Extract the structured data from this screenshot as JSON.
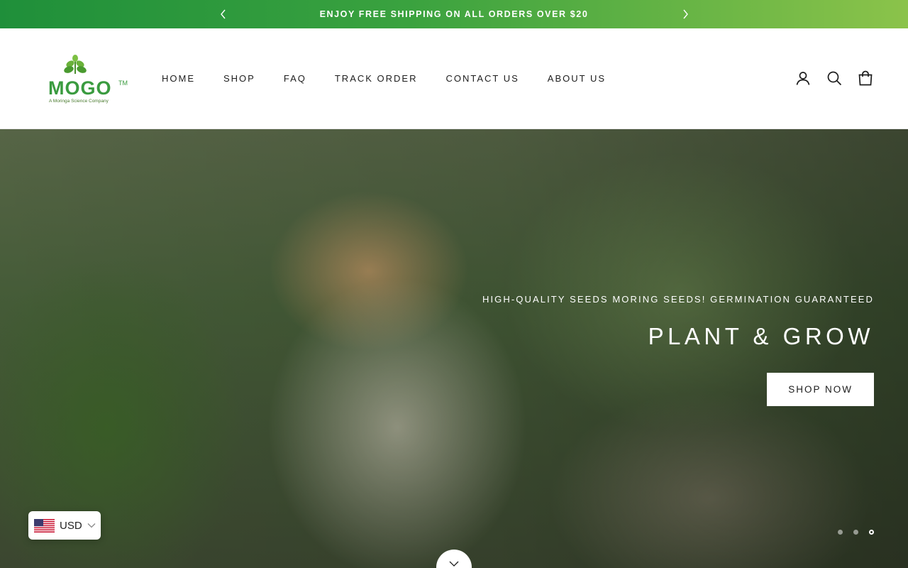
{
  "announcement": {
    "text": "ENJOY FREE SHIPPING ON ALL ORDERS OVER $20",
    "prev_icon": "chevron-left-icon",
    "next_icon": "chevron-right-icon"
  },
  "header": {
    "logo": {
      "name": "MOGO",
      "tm": "TM",
      "tagline": "A Moringa Science Company"
    },
    "nav": [
      {
        "label": "HOME"
      },
      {
        "label": "SHOP"
      },
      {
        "label": "FAQ"
      },
      {
        "label": "TRACK ORDER"
      },
      {
        "label": "CONTACT US"
      },
      {
        "label": "ABOUT US"
      }
    ],
    "icons": [
      "account-icon",
      "search-icon",
      "cart-icon"
    ]
  },
  "hero": {
    "subtitle": "HIGH-QUALITY SEEDS MORING SEEDS! GERMINATION GUARANTEED",
    "title": "PLANT & GROW",
    "button": "SHOP NOW",
    "slides": {
      "count": 3,
      "active": 3
    }
  },
  "currency": {
    "code": "USD"
  },
  "colors": {
    "brand_green": "#3a9b3f",
    "announce_start": "#1f8f3a",
    "announce_end": "#8bc34a"
  }
}
